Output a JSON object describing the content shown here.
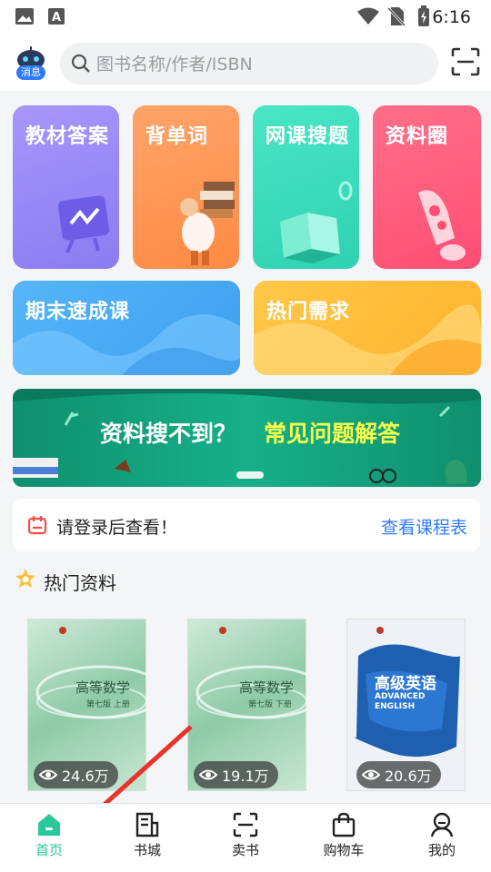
{
  "status_bar": {
    "time": "6:16"
  },
  "header": {
    "robot_badge": "消息",
    "search_placeholder": "图书名称/作者/ISBN"
  },
  "grid": [
    {
      "label": "教材答案",
      "color": "#9b8cf5"
    },
    {
      "label": "背单词",
      "color": "#ff9a55"
    },
    {
      "label": "网课搜题",
      "color": "#3fd9b8"
    },
    {
      "label": "资料圈",
      "color": "#ff5c7c"
    }
  ],
  "wide_cards": [
    {
      "label": "期末速成课",
      "color": "#4aa8f0"
    },
    {
      "label": "热门需求",
      "color": "#ffbf3a"
    }
  ],
  "banner": {
    "text_white": "资料搜不到？",
    "text_yellow": "常见问题解答"
  },
  "notice": {
    "text": "请登录后查看！",
    "link": "查看课程表"
  },
  "hot_section": {
    "title": "热门资料"
  },
  "books": [
    {
      "views": "24.6万",
      "title": "高等数学",
      "sub": "第七版 上册"
    },
    {
      "views": "19.1万",
      "title": "高等数学",
      "sub": "第七版 下册"
    },
    {
      "views": "20.6万",
      "title": "高级英语",
      "sub": "ADVANCED ENGLISH"
    }
  ],
  "tabs": [
    {
      "label": "首页",
      "active": true
    },
    {
      "label": "书城"
    },
    {
      "label": "卖书"
    },
    {
      "label": "购物车"
    },
    {
      "label": "我的"
    }
  ]
}
